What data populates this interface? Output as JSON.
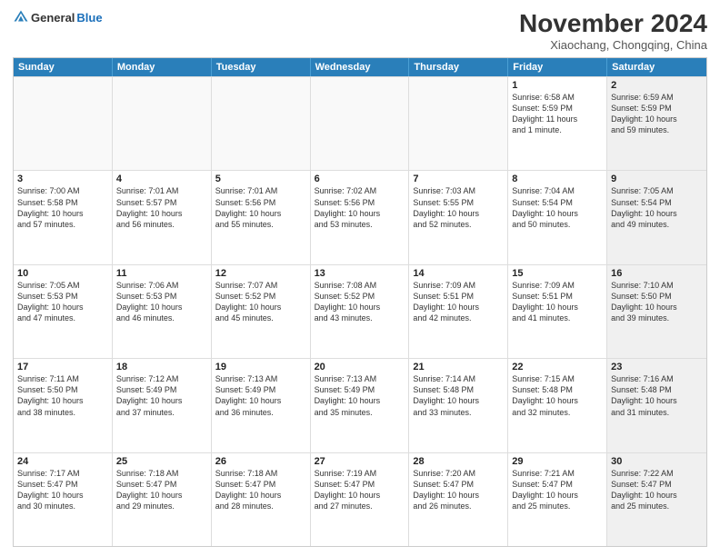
{
  "header": {
    "logo_general": "General",
    "logo_blue": "Blue",
    "title": "November 2024",
    "location": "Xiaochang, Chongqing, China"
  },
  "calendar": {
    "days": [
      "Sunday",
      "Monday",
      "Tuesday",
      "Wednesday",
      "Thursday",
      "Friday",
      "Saturday"
    ],
    "rows": [
      [
        {
          "day": "",
          "empty": true
        },
        {
          "day": "",
          "empty": true
        },
        {
          "day": "",
          "empty": true
        },
        {
          "day": "",
          "empty": true
        },
        {
          "day": "",
          "empty": true
        },
        {
          "day": "1",
          "lines": [
            "Sunrise: 6:58 AM",
            "Sunset: 5:59 PM",
            "Daylight: 11 hours",
            "and 1 minute."
          ]
        },
        {
          "day": "2",
          "shaded": true,
          "lines": [
            "Sunrise: 6:59 AM",
            "Sunset: 5:59 PM",
            "Daylight: 10 hours",
            "and 59 minutes."
          ]
        }
      ],
      [
        {
          "day": "3",
          "lines": [
            "Sunrise: 7:00 AM",
            "Sunset: 5:58 PM",
            "Daylight: 10 hours",
            "and 57 minutes."
          ]
        },
        {
          "day": "4",
          "lines": [
            "Sunrise: 7:01 AM",
            "Sunset: 5:57 PM",
            "Daylight: 10 hours",
            "and 56 minutes."
          ]
        },
        {
          "day": "5",
          "lines": [
            "Sunrise: 7:01 AM",
            "Sunset: 5:56 PM",
            "Daylight: 10 hours",
            "and 55 minutes."
          ]
        },
        {
          "day": "6",
          "lines": [
            "Sunrise: 7:02 AM",
            "Sunset: 5:56 PM",
            "Daylight: 10 hours",
            "and 53 minutes."
          ]
        },
        {
          "day": "7",
          "lines": [
            "Sunrise: 7:03 AM",
            "Sunset: 5:55 PM",
            "Daylight: 10 hours",
            "and 52 minutes."
          ]
        },
        {
          "day": "8",
          "lines": [
            "Sunrise: 7:04 AM",
            "Sunset: 5:54 PM",
            "Daylight: 10 hours",
            "and 50 minutes."
          ]
        },
        {
          "day": "9",
          "shaded": true,
          "lines": [
            "Sunrise: 7:05 AM",
            "Sunset: 5:54 PM",
            "Daylight: 10 hours",
            "and 49 minutes."
          ]
        }
      ],
      [
        {
          "day": "10",
          "lines": [
            "Sunrise: 7:05 AM",
            "Sunset: 5:53 PM",
            "Daylight: 10 hours",
            "and 47 minutes."
          ]
        },
        {
          "day": "11",
          "lines": [
            "Sunrise: 7:06 AM",
            "Sunset: 5:53 PM",
            "Daylight: 10 hours",
            "and 46 minutes."
          ]
        },
        {
          "day": "12",
          "lines": [
            "Sunrise: 7:07 AM",
            "Sunset: 5:52 PM",
            "Daylight: 10 hours",
            "and 45 minutes."
          ]
        },
        {
          "day": "13",
          "lines": [
            "Sunrise: 7:08 AM",
            "Sunset: 5:52 PM",
            "Daylight: 10 hours",
            "and 43 minutes."
          ]
        },
        {
          "day": "14",
          "lines": [
            "Sunrise: 7:09 AM",
            "Sunset: 5:51 PM",
            "Daylight: 10 hours",
            "and 42 minutes."
          ]
        },
        {
          "day": "15",
          "lines": [
            "Sunrise: 7:09 AM",
            "Sunset: 5:51 PM",
            "Daylight: 10 hours",
            "and 41 minutes."
          ]
        },
        {
          "day": "16",
          "shaded": true,
          "lines": [
            "Sunrise: 7:10 AM",
            "Sunset: 5:50 PM",
            "Daylight: 10 hours",
            "and 39 minutes."
          ]
        }
      ],
      [
        {
          "day": "17",
          "lines": [
            "Sunrise: 7:11 AM",
            "Sunset: 5:50 PM",
            "Daylight: 10 hours",
            "and 38 minutes."
          ]
        },
        {
          "day": "18",
          "lines": [
            "Sunrise: 7:12 AM",
            "Sunset: 5:49 PM",
            "Daylight: 10 hours",
            "and 37 minutes."
          ]
        },
        {
          "day": "19",
          "lines": [
            "Sunrise: 7:13 AM",
            "Sunset: 5:49 PM",
            "Daylight: 10 hours",
            "and 36 minutes."
          ]
        },
        {
          "day": "20",
          "lines": [
            "Sunrise: 7:13 AM",
            "Sunset: 5:49 PM",
            "Daylight: 10 hours",
            "and 35 minutes."
          ]
        },
        {
          "day": "21",
          "lines": [
            "Sunrise: 7:14 AM",
            "Sunset: 5:48 PM",
            "Daylight: 10 hours",
            "and 33 minutes."
          ]
        },
        {
          "day": "22",
          "lines": [
            "Sunrise: 7:15 AM",
            "Sunset: 5:48 PM",
            "Daylight: 10 hours",
            "and 32 minutes."
          ]
        },
        {
          "day": "23",
          "shaded": true,
          "lines": [
            "Sunrise: 7:16 AM",
            "Sunset: 5:48 PM",
            "Daylight: 10 hours",
            "and 31 minutes."
          ]
        }
      ],
      [
        {
          "day": "24",
          "lines": [
            "Sunrise: 7:17 AM",
            "Sunset: 5:47 PM",
            "Daylight: 10 hours",
            "and 30 minutes."
          ]
        },
        {
          "day": "25",
          "lines": [
            "Sunrise: 7:18 AM",
            "Sunset: 5:47 PM",
            "Daylight: 10 hours",
            "and 29 minutes."
          ]
        },
        {
          "day": "26",
          "lines": [
            "Sunrise: 7:18 AM",
            "Sunset: 5:47 PM",
            "Daylight: 10 hours",
            "and 28 minutes."
          ]
        },
        {
          "day": "27",
          "lines": [
            "Sunrise: 7:19 AM",
            "Sunset: 5:47 PM",
            "Daylight: 10 hours",
            "and 27 minutes."
          ]
        },
        {
          "day": "28",
          "lines": [
            "Sunrise: 7:20 AM",
            "Sunset: 5:47 PM",
            "Daylight: 10 hours",
            "and 26 minutes."
          ]
        },
        {
          "day": "29",
          "lines": [
            "Sunrise: 7:21 AM",
            "Sunset: 5:47 PM",
            "Daylight: 10 hours",
            "and 25 minutes."
          ]
        },
        {
          "day": "30",
          "shaded": true,
          "lines": [
            "Sunrise: 7:22 AM",
            "Sunset: 5:47 PM",
            "Daylight: 10 hours",
            "and 25 minutes."
          ]
        }
      ]
    ]
  }
}
